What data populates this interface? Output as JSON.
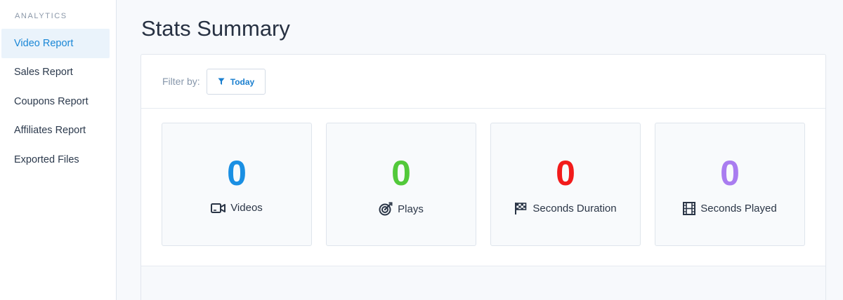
{
  "sidebar": {
    "heading": "ANALYTICS",
    "items": [
      {
        "label": "Video Report",
        "active": true
      },
      {
        "label": "Sales Report",
        "active": false
      },
      {
        "label": "Coupons Report",
        "active": false
      },
      {
        "label": "Affiliates Report",
        "active": false
      },
      {
        "label": "Exported Files",
        "active": false
      }
    ]
  },
  "main": {
    "title": "Stats Summary",
    "filter": {
      "label": "Filter by:",
      "button_label": "Today",
      "button_icon": "filter-icon"
    },
    "stats": [
      {
        "value": "0",
        "label": "Videos",
        "icon": "video-camera-icon",
        "color": "#1a8fe3"
      },
      {
        "value": "0",
        "label": "Plays",
        "icon": "target-icon",
        "color": "#52c93a"
      },
      {
        "value": "0",
        "label": "Seconds Duration",
        "icon": "checkered-flag-icon",
        "color": "#f21b1b"
      },
      {
        "value": "0",
        "label": "Seconds Played",
        "icon": "film-icon",
        "color": "#a97cf0"
      }
    ]
  }
}
